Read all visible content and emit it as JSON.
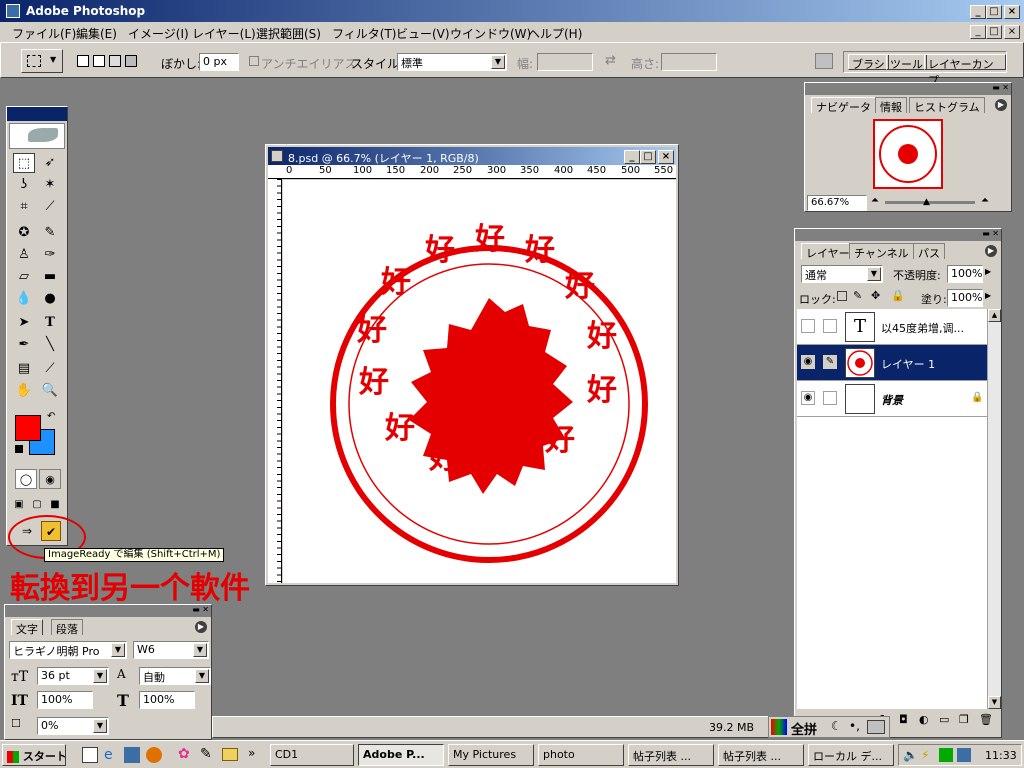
{
  "app": {
    "title": "Adobe Photoshop"
  },
  "menu": [
    "ファイル(F)",
    "編集(E)",
    "イメージ(I)",
    "レイヤー(L)",
    "選択範囲(S)",
    "フィルタ(T)",
    "ビュー(V)",
    "ウインドウ(W)",
    "ヘルプ(H)"
  ],
  "options": {
    "feather_label": "ぼかし:",
    "feather_value": "0 px",
    "antialias_label": "アンチエイリアス",
    "style_label": "スタイル:",
    "style_value": "標準",
    "width_label": "幅:",
    "height_label": "高さ:",
    "palette_tabs": [
      "ブラシ",
      "ツール",
      "レイヤーカンプ"
    ]
  },
  "document": {
    "title": "8.psd @ 66.7% (レイヤー 1, RGB/8)",
    "ruler_ticks": [
      "0",
      "50",
      "100",
      "150",
      "200",
      "250",
      "300",
      "350",
      "400",
      "450",
      "500",
      "550"
    ],
    "stamp_char": "好"
  },
  "tooltip": "ImageReady で編集 (Shift+Ctrl+M)",
  "annotation": "転換到另一个軟件",
  "navigator": {
    "tabs": [
      "ナビゲータ",
      "情報",
      "ヒストグラム"
    ],
    "zoom": "66.67%"
  },
  "layers": {
    "tabs": [
      "レイヤー",
      "チャンネル",
      "パス"
    ],
    "blend_mode": "通常",
    "opacity_label": "不透明度:",
    "opacity_value": "100%",
    "lock_label": "ロック:",
    "fill_label": "塗り:",
    "fill_value": "100%",
    "rows": [
      {
        "name": "以45度弟增,调...",
        "thumb": "T"
      },
      {
        "name": "レイヤー 1",
        "thumb": ""
      },
      {
        "name": "背景",
        "thumb": ""
      }
    ]
  },
  "character": {
    "tabs": [
      "文字",
      "段落"
    ],
    "font": "ヒラギノ明朝 Pro",
    "weight": "W6",
    "size": "36 pt",
    "leading": "自動",
    "vscale": "100%",
    "hscale": "100%",
    "tracking": "0%"
  },
  "status": {
    "memory": "39.2 MB",
    "ime": "全拼"
  },
  "taskbar": {
    "start": "スタート",
    "buttons": [
      "CD1",
      "Adobe P...",
      "My Pictures",
      "photo",
      "帖子列表 ...",
      "帖子列表 ...",
      "ローカル デ..."
    ],
    "clock": "11:33"
  },
  "colors": {
    "fg": "#ff0000",
    "bg": "#1e90ff",
    "stamp": "#e40000"
  }
}
